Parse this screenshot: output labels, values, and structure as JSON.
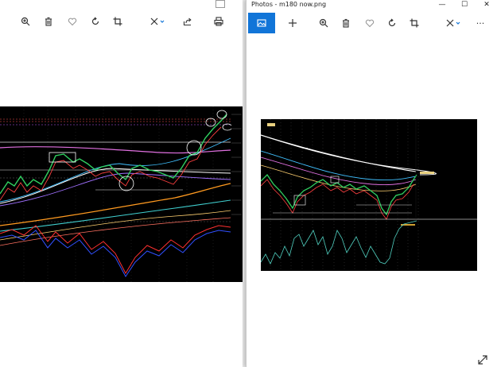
{
  "left_window": {
    "toolbar": [
      {
        "icon": "zoom-in-icon",
        "label": ""
      },
      {
        "icon": "delete-icon",
        "label": ""
      },
      {
        "icon": "favorite-icon",
        "label": ""
      },
      {
        "icon": "rotate-icon",
        "label": ""
      },
      {
        "icon": "crop-icon",
        "label": ""
      },
      {
        "icon": "edit-icon",
        "label": ""
      },
      {
        "icon": "share-icon",
        "label": ""
      },
      {
        "icon": "print-icon",
        "label": ""
      }
    ]
  },
  "right_window": {
    "title": "Photos - m180 now.png",
    "controls": {
      "minimize": "—",
      "maximize": "☐",
      "close": "✕"
    },
    "toolbar": [
      {
        "icon": "view-image-icon",
        "active": true
      },
      {
        "icon": "add-icon"
      },
      {
        "icon": "zoom-in-icon"
      },
      {
        "icon": "delete-icon"
      },
      {
        "icon": "favorite-icon"
      },
      {
        "icon": "rotate-icon"
      },
      {
        "icon": "crop-icon"
      },
      {
        "icon": "edit-icon"
      },
      {
        "icon": "more-icon"
      }
    ],
    "more_label": "···"
  },
  "colors": {
    "accent": "#1175d8",
    "chart_bg": "#000000"
  }
}
